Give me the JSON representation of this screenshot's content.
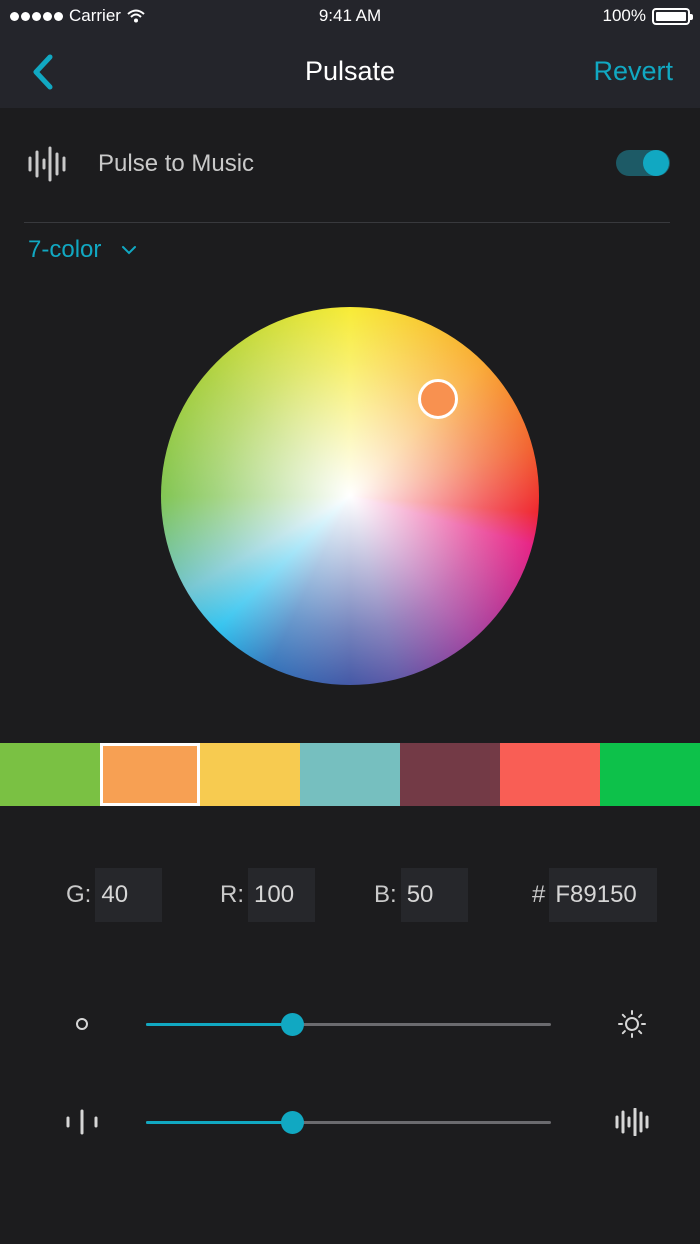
{
  "status_bar": {
    "carrier": "Carrier",
    "time": "9:41 AM",
    "battery": "100%"
  },
  "nav": {
    "title": "Pulsate",
    "revert_label": "Revert",
    "back_icon": "chevron-left-icon"
  },
  "pulse_to_music": {
    "label": "Pulse to Music",
    "enabled": true
  },
  "mode": {
    "label": "7-color"
  },
  "color_wheel": {
    "selected_color": "#F89150"
  },
  "swatches": [
    {
      "color": "#7ac143",
      "selected": false
    },
    {
      "color": "#f7a053",
      "selected": true
    },
    {
      "color": "#f7cb50",
      "selected": false
    },
    {
      "color": "#76bfbf",
      "selected": false
    },
    {
      "color": "#733a46",
      "selected": false
    },
    {
      "color": "#f95e55",
      "selected": false
    },
    {
      "color": "#0dc14a",
      "selected": false
    }
  ],
  "rgb": {
    "g_label": "G:",
    "g_value": "40",
    "r_label": "R:",
    "r_value": "100",
    "b_label": "B:",
    "b_value": "50",
    "hex_label": "#",
    "hex_value": "F89150"
  },
  "sliders": {
    "brightness": {
      "value_percent": 36,
      "left_icon": "dim-circle-icon",
      "right_icon": "sun-icon"
    },
    "pulse_intensity": {
      "value_percent": 36,
      "left_icon": "small-waveform-icon",
      "right_icon": "large-waveform-icon"
    }
  },
  "colors": {
    "accent": "#11a8c2",
    "background": "#1c1c1e",
    "nav_background": "#24252b"
  }
}
